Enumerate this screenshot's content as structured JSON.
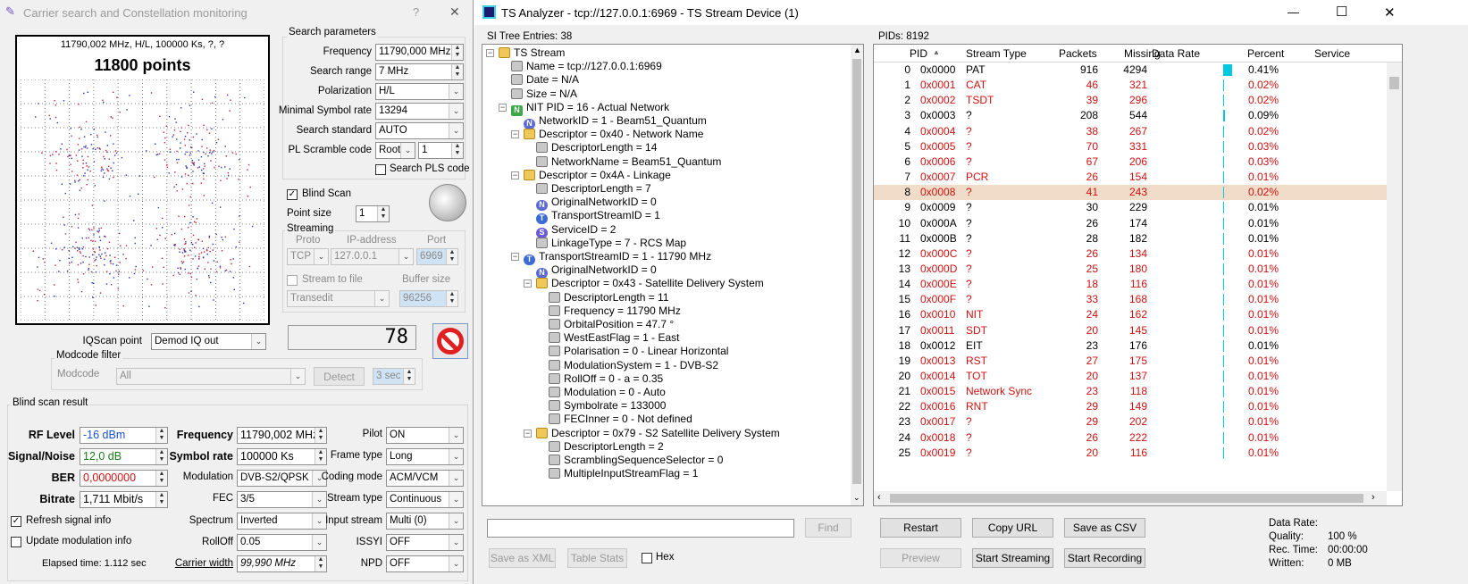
{
  "left_window": {
    "title": "Carrier search and Constellation monitoring",
    "help": "?",
    "close": "✕",
    "constellation": {
      "header": "11790,002 MHz, H/L, 100000 Ks, ?, ?",
      "points": "11800 points"
    },
    "search_params": {
      "legend": "Search parameters",
      "frequency_label": "Frequency",
      "frequency_value": "11790,000 MHz",
      "range_label": "Search range",
      "range_value": "7 MHz",
      "polarization_label": "Polarization",
      "polarization_value": "H/L",
      "minsr_label": "Minimal Symbol rate",
      "minsr_value": "13294",
      "standard_label": "Search standard",
      "standard_value": "AUTO",
      "pl_label": "PL Scramble code",
      "pl_mode": "Root",
      "pl_value": "1",
      "search_pls": "Search PLS code"
    },
    "blind_scan": "Blind Scan",
    "point_size_label": "Point size",
    "point_size_value": "1",
    "streaming": {
      "legend": "Streaming",
      "proto_h": "Proto",
      "ip_h": "IP-address",
      "port_h": "Port",
      "proto": "TCP",
      "ip": "127.0.0.1",
      "port": "6969",
      "stream_to_file": "Stream to file",
      "buffer_label": "Buffer size",
      "target": "Transedit",
      "buffer": "96256"
    },
    "counter": "78",
    "iqscan_label": "IQScan point",
    "iqscan_value": "Demod IQ out",
    "modcode": {
      "legend": "Modcode filter",
      "label": "Modcode",
      "value": "All",
      "detect": "Detect",
      "timeout": "3 sec"
    },
    "result": {
      "legend": "Blind scan result",
      "rf_label": "RF Level",
      "rf_value": "-16 dBm",
      "sn_label": "Signal/Noise",
      "sn_value": "12,0 dB",
      "ber_label": "BER",
      "ber_value": "0,0000000",
      "bitrate_label": "Bitrate",
      "bitrate_value": "1,711 Mbit/s",
      "freq_label": "Frequency",
      "freq_value": "11790,002 MHz",
      "sr_label": "Symbol rate",
      "sr_value": "100000 Ks",
      "mod_label": "Modulation",
      "mod_value": "DVB-S2/QPSK",
      "fec_label": "FEC",
      "fec_value": "3/5",
      "spectrum_label": "Spectrum",
      "spectrum_value": "Inverted",
      "rolloff_label": "RollOff",
      "rolloff_value": "0.05",
      "cw_label": "Carrier width",
      "cw_value": "99,990 MHz",
      "pilot_label": "Pilot",
      "pilot_value": "ON",
      "frame_label": "Frame type",
      "frame_value": "Long",
      "coding_label": "Coding mode",
      "coding_value": "ACM/VCM",
      "streamtype_label": "Stream type",
      "streamtype_value": "Continuous",
      "input_label": "Input stream",
      "input_value": "Multi (0)",
      "issyi_label": "ISSYI",
      "issyi_value": "OFF",
      "npd_label": "NPD",
      "npd_value": "OFF",
      "refresh": "Refresh signal info",
      "update": "Update modulation info",
      "elapsed": "Elapsed time: 1.112 sec"
    }
  },
  "right_window": {
    "title": "TS Analyzer - tcp://127.0.0.1:6969 - TS Stream Device (1)",
    "min": "—",
    "max": "☐",
    "close": "✕",
    "si_header": "SI Tree Entries: 38",
    "pids_header": "PIDs: 8192",
    "tree": [
      {
        "t": "TS Stream",
        "d": 0,
        "i": "f",
        "e": "−"
      },
      {
        "t": "Name = tcp://127.0.0.1:6969",
        "d": 1,
        "i": "g"
      },
      {
        "t": "Date = N/A",
        "d": 1,
        "i": "g"
      },
      {
        "t": "Size = N/A",
        "d": 1,
        "i": "g"
      },
      {
        "t": "NIT PID = 16 - Actual Network",
        "d": 1,
        "i": "NG",
        "ic": "N",
        "e": "−"
      },
      {
        "t": "NetworkID = 1 - Beam51_Quantum",
        "d": 2,
        "i": "N",
        "ic": "N"
      },
      {
        "t": "Descriptor = 0x40 - Network Name",
        "d": 2,
        "i": "f",
        "e": "−"
      },
      {
        "t": "DescriptorLength = 14",
        "d": 3,
        "i": "g"
      },
      {
        "t": "NetworkName = Beam51_Quantum",
        "d": 3,
        "i": "g"
      },
      {
        "t": "Descriptor = 0x4A - Linkage",
        "d": 2,
        "i": "f",
        "e": "−"
      },
      {
        "t": "DescriptorLength = 7",
        "d": 3,
        "i": "g"
      },
      {
        "t": "OriginalNetworkID = 0",
        "d": 3,
        "i": "N",
        "ic": "N"
      },
      {
        "t": "TransportStreamID = 1",
        "d": 3,
        "i": "T",
        "ic": "T"
      },
      {
        "t": "ServiceID = 2",
        "d": 3,
        "i": "S",
        "ic": "S"
      },
      {
        "t": "LinkageType = 7 - RCS Map",
        "d": 3,
        "i": "g"
      },
      {
        "t": "TransportStreamID = 1 - 11790 MHz",
        "d": 2,
        "i": "T",
        "ic": "T",
        "e": "−"
      },
      {
        "t": "OriginalNetworkID = 0",
        "d": 3,
        "i": "N",
        "ic": "N"
      },
      {
        "t": "Descriptor = 0x43 - Satellite Delivery System",
        "d": 3,
        "i": "f",
        "e": "−"
      },
      {
        "t": "DescriptorLength = 11",
        "d": 4,
        "i": "g"
      },
      {
        "t": "Frequency = 11790 MHz",
        "d": 4,
        "i": "g"
      },
      {
        "t": "OrbitalPosition = 47.7 °",
        "d": 4,
        "i": "g"
      },
      {
        "t": "WestEastFlag = 1 - East",
        "d": 4,
        "i": "g"
      },
      {
        "t": "Polarisation = 0 - Linear Horizontal",
        "d": 4,
        "i": "g"
      },
      {
        "t": "ModulationSystem = 1 - DVB-S2",
        "d": 4,
        "i": "g"
      },
      {
        "t": "RollOff = 0 - a = 0.35",
        "d": 4,
        "i": "g"
      },
      {
        "t": "Modulation = 0 - Auto",
        "d": 4,
        "i": "g"
      },
      {
        "t": "Symbolrate = 133000",
        "d": 4,
        "i": "g"
      },
      {
        "t": "FECInner = 0 - Not defined",
        "d": 4,
        "i": "g"
      },
      {
        "t": "Descriptor = 0x79 - S2 Satellite Delivery System",
        "d": 3,
        "i": "f",
        "e": "−"
      },
      {
        "t": "DescriptorLength = 2",
        "d": 4,
        "i": "g"
      },
      {
        "t": "ScramblingSequenceSelector = 0",
        "d": 4,
        "i": "g"
      },
      {
        "t": "MultipleInputStreamFlag = 1",
        "d": 4,
        "i": "g"
      }
    ],
    "find_btn": "Find",
    "save_xml": "Save as XML",
    "table_stats": "Table Stats",
    "hex": "Hex",
    "columns": [
      "PID",
      "Stream Type",
      "Packets",
      "Missing",
      "Data Rate",
      "Percent",
      "Service"
    ],
    "pids": [
      {
        "n": "0",
        "h": "0x0000",
        "s": "PAT",
        "p": "916",
        "m": "4294",
        "pc": "0.41%",
        "c": "blk",
        "bar": 0.041
      },
      {
        "n": "1",
        "h": "0x0001",
        "s": "CAT",
        "p": "46",
        "m": "321",
        "pc": "0.02%",
        "c": "red",
        "bar": 0.002
      },
      {
        "n": "2",
        "h": "0x0002",
        "s": "TSDT",
        "p": "39",
        "m": "296",
        "pc": "0.02%",
        "c": "red",
        "bar": 0.002
      },
      {
        "n": "3",
        "h": "0x0003",
        "s": "?",
        "p": "208",
        "m": "544",
        "pc": "0.09%",
        "c": "blk",
        "bar": 0.009
      },
      {
        "n": "4",
        "h": "0x0004",
        "s": "?",
        "p": "38",
        "m": "267",
        "pc": "0.02%",
        "c": "red",
        "bar": 0.002
      },
      {
        "n": "5",
        "h": "0x0005",
        "s": "?",
        "p": "70",
        "m": "331",
        "pc": "0.03%",
        "c": "red",
        "bar": 0.003
      },
      {
        "n": "6",
        "h": "0x0006",
        "s": "?",
        "p": "67",
        "m": "206",
        "pc": "0.03%",
        "c": "red",
        "bar": 0.003
      },
      {
        "n": "7",
        "h": "0x0007",
        "s": "PCR",
        "p": "26",
        "m": "154",
        "pc": "0.01%",
        "c": "red",
        "bar": 0.001
      },
      {
        "n": "8",
        "h": "0x0008",
        "s": "?",
        "p": "41",
        "m": "243",
        "pc": "0.02%",
        "c": "red",
        "bar": 0.002,
        "sel": true
      },
      {
        "n": "9",
        "h": "0x0009",
        "s": "?",
        "p": "30",
        "m": "229",
        "pc": "0.01%",
        "c": "blk",
        "bar": 0.001
      },
      {
        "n": "10",
        "h": "0x000A",
        "s": "?",
        "p": "26",
        "m": "174",
        "pc": "0.01%",
        "c": "blk",
        "bar": 0.001
      },
      {
        "n": "11",
        "h": "0x000B",
        "s": "?",
        "p": "28",
        "m": "182",
        "pc": "0.01%",
        "c": "blk",
        "bar": 0.001
      },
      {
        "n": "12",
        "h": "0x000C",
        "s": "?",
        "p": "26",
        "m": "134",
        "pc": "0.01%",
        "c": "red",
        "bar": 0.001
      },
      {
        "n": "13",
        "h": "0x000D",
        "s": "?",
        "p": "25",
        "m": "180",
        "pc": "0.01%",
        "c": "red",
        "bar": 0.001
      },
      {
        "n": "14",
        "h": "0x000E",
        "s": "?",
        "p": "18",
        "m": "116",
        "pc": "0.01%",
        "c": "red",
        "bar": 0.001
      },
      {
        "n": "15",
        "h": "0x000F",
        "s": "?",
        "p": "33",
        "m": "168",
        "pc": "0.01%",
        "c": "red",
        "bar": 0.001
      },
      {
        "n": "16",
        "h": "0x0010",
        "s": "NIT",
        "p": "24",
        "m": "162",
        "pc": "0.01%",
        "c": "red",
        "bar": 0.001
      },
      {
        "n": "17",
        "h": "0x0011",
        "s": "SDT",
        "p": "20",
        "m": "145",
        "pc": "0.01%",
        "c": "red",
        "bar": 0.001
      },
      {
        "n": "18",
        "h": "0x0012",
        "s": "EIT",
        "p": "23",
        "m": "176",
        "pc": "0.01%",
        "c": "blk",
        "bar": 0.001
      },
      {
        "n": "19",
        "h": "0x0013",
        "s": "RST",
        "p": "27",
        "m": "175",
        "pc": "0.01%",
        "c": "red",
        "bar": 0.001
      },
      {
        "n": "20",
        "h": "0x0014",
        "s": "TOT",
        "p": "20",
        "m": "137",
        "pc": "0.01%",
        "c": "red",
        "bar": 0.001
      },
      {
        "n": "21",
        "h": "0x0015",
        "s": "Network Sync",
        "p": "23",
        "m": "118",
        "pc": "0.01%",
        "c": "red",
        "bar": 0.001
      },
      {
        "n": "22",
        "h": "0x0016",
        "s": "RNT",
        "p": "29",
        "m": "149",
        "pc": "0.01%",
        "c": "red",
        "bar": 0.001
      },
      {
        "n": "23",
        "h": "0x0017",
        "s": "?",
        "p": "29",
        "m": "202",
        "pc": "0.01%",
        "c": "red",
        "bar": 0.001
      },
      {
        "n": "24",
        "h": "0x0018",
        "s": "?",
        "p": "26",
        "m": "222",
        "pc": "0.01%",
        "c": "red",
        "bar": 0.001
      },
      {
        "n": "25",
        "h": "0x0019",
        "s": "?",
        "p": "20",
        "m": "116",
        "pc": "0.01%",
        "c": "red",
        "bar": 0.001
      }
    ],
    "restart": "Restart",
    "copy_url": "Copy URL",
    "save_csv": "Save as CSV",
    "preview": "Preview",
    "start_streaming": "Start Streaming",
    "start_recording": "Start Recording",
    "stats": {
      "rate_label": "Data Rate:",
      "rate_value": "",
      "quality_label": "Quality:",
      "quality_value": "100 %",
      "rec_label": "Rec. Time:",
      "rec_value": "00:00:00",
      "written_label": "Written:",
      "written_value": "0 MB"
    }
  },
  "colors": {
    "accent": "#00c8e0",
    "selected_row": "#f0dcc8",
    "red_text": "#d01010",
    "blue_value": "#1a4fd0",
    "green_value": "#1a7a1a"
  }
}
